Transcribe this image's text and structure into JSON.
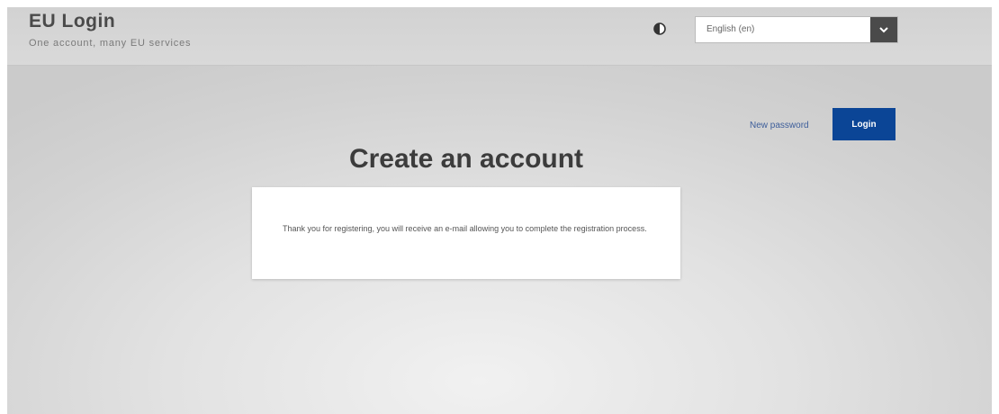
{
  "header": {
    "brand_title": "EU Login",
    "brand_subtitle": "One account, many EU services",
    "contrast_icon": "contrast-icon",
    "language": {
      "selected": "English (en)",
      "dropdown_icon": "chevron-down-icon"
    }
  },
  "actions": {
    "new_password_label": "New password",
    "login_label": "Login"
  },
  "main": {
    "title": "Create an account",
    "message": "Thank you for registering, you will receive an e-mail allowing you to complete the registration process."
  },
  "colors": {
    "login_button": "#0b4596",
    "link": "#3d5e9a",
    "select_button": "#4a4a4a"
  }
}
